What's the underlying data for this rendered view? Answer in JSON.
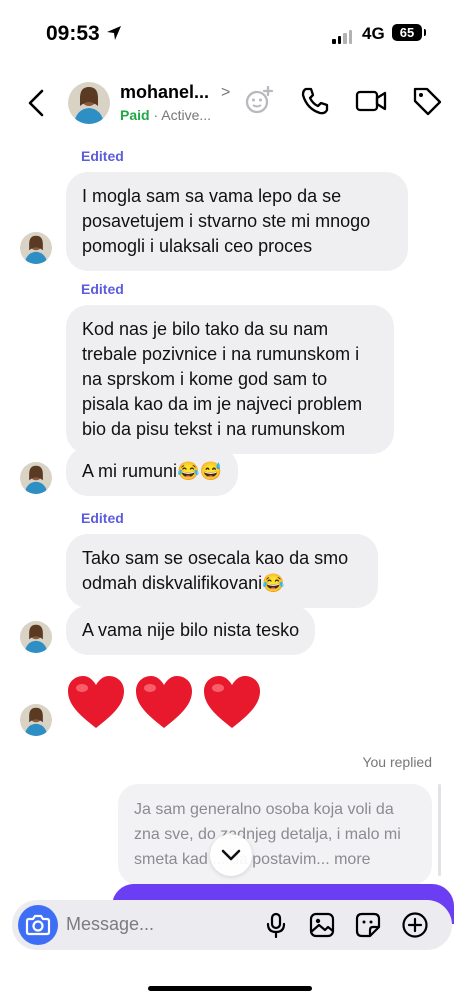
{
  "status_bar": {
    "time": "09:53",
    "network": "4G",
    "battery": "65"
  },
  "header": {
    "name": "mohanel...",
    "chevron": ">",
    "paid_label": "Paid",
    "separator": " · ",
    "status": "Active..."
  },
  "messages": {
    "edited_label": "Edited",
    "m1": "I mogla sam sa vama lepo da se\nposavetujem i stvarno ste mi mnogo\npomogli i ulaksali ceo proces",
    "m2": "Kod nas je bilo tako da su nam\ntrebale pozivnice i na rumunskom i\nna sprskom i kome god sam to\npisala kao da im je najveci problem\nbio da pisu tekst i na rumunskom",
    "m3": "A mi rumuni😂😅",
    "m4": "Tako sam se osecala kao da smo\nodmah diskvalifikovani😂",
    "m5": "A vama nije bilo nista tesko",
    "hearts": [
      "❤️",
      "❤️",
      "❤️"
    ]
  },
  "reply": {
    "label": "You replied",
    "text": "Ja sam generalno osoba koja voli da zna sve, do zadnjeg detalja, i malo mi smeta kad ... da postavim...",
    "more": "more"
  },
  "composer": {
    "placeholder": "Message..."
  },
  "colors": {
    "accent": "#6c3ef3",
    "edited": "#5b5ce0",
    "paid": "#22a747",
    "bubble": "#efeff2",
    "camera": "#3e6ef5"
  }
}
